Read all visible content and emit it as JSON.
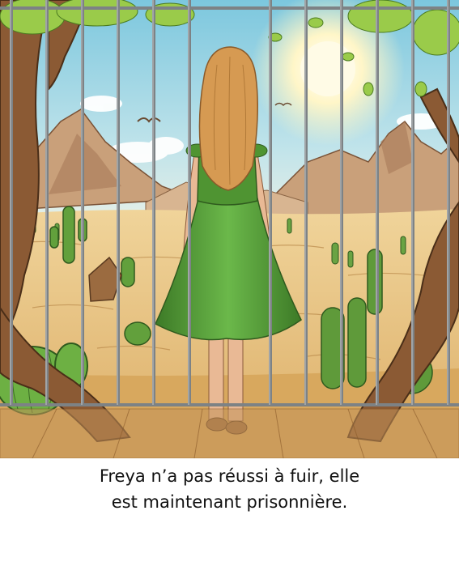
{
  "illustration": {
    "icons": [
      "desert-scene",
      "cage-bars",
      "girl-in-green-dress",
      "sun",
      "mountains",
      "cactus",
      "tree-roots",
      "bird"
    ],
    "colors": {
      "sky_top": "#7cc7de",
      "sky_bottom": "#dff0f0",
      "sun": "#fff6c8",
      "mountain": "#c79a74",
      "mountain_shadow": "#a97a58",
      "sand": "#e8c485",
      "sand_dark": "#c99a58",
      "dress": "#5aa53c",
      "dress_dark": "#3d7a27",
      "hair": "#d69a52",
      "skin": "#e9b995",
      "bars": "#8a8f93",
      "wood": "#8b5a34",
      "cactus": "#5f9a3a",
      "leaves": "#9acb4a"
    }
  },
  "caption": {
    "line1": "Freya n’a pas réussi à fuir, elle",
    "line2": "est maintenant prisonnière."
  }
}
